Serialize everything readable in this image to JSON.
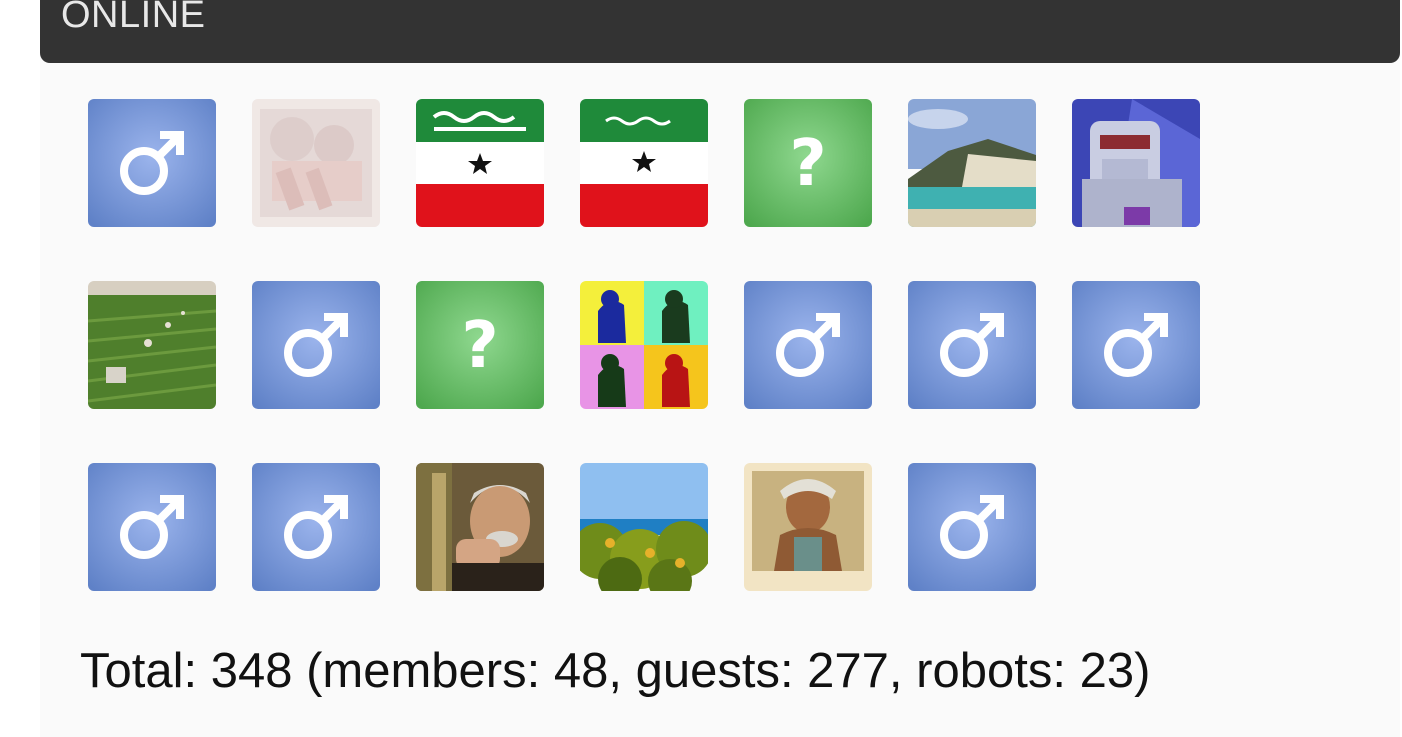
{
  "header": {
    "title": "ONLINE"
  },
  "avatars": [
    {
      "kind": "male-default-icon"
    },
    {
      "kind": "poster-photo"
    },
    {
      "kind": "flag-photo"
    },
    {
      "kind": "flag-photo"
    },
    {
      "kind": "unknown-default-icon"
    },
    {
      "kind": "beach-photo"
    },
    {
      "kind": "robot-photo"
    },
    {
      "kind": "farm-photo"
    },
    {
      "kind": "male-default-icon"
    },
    {
      "kind": "unknown-default-icon"
    },
    {
      "kind": "popart-photo"
    },
    {
      "kind": "male-default-icon"
    },
    {
      "kind": "male-default-icon"
    },
    {
      "kind": "male-default-icon"
    },
    {
      "kind": "male-default-icon"
    },
    {
      "kind": "male-default-icon"
    },
    {
      "kind": "man-photo"
    },
    {
      "kind": "coast-photo"
    },
    {
      "kind": "painting-photo"
    },
    {
      "kind": "male-default-icon"
    }
  ],
  "footer": {
    "total_text": "Total: 348 (members: 48, guests: 277, robots: 23)"
  },
  "colors": {
    "header_bg": "#333333",
    "male_icon_bg": "#6b8fd6",
    "unknown_icon_bg": "#5cb85c"
  }
}
